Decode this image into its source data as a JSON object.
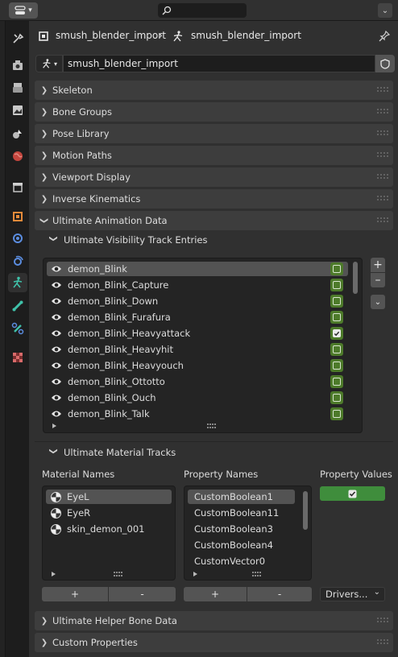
{
  "header": {
    "object_name": "smush_blender_import",
    "armature_name": "smush_blender_import"
  },
  "name_field": {
    "value": "smush_blender_import"
  },
  "sections": {
    "skeleton": "Skeleton",
    "bone_groups": "Bone Groups",
    "pose_library": "Pose Library",
    "motion_paths": "Motion Paths",
    "viewport_display": "Viewport Display",
    "inverse_kinematics": "Inverse Kinematics",
    "ultimate_animation_data": "Ultimate Animation Data",
    "ultimate_visibility_track_entries": "Ultimate Visibility Track Entries",
    "ultimate_material_tracks": "Ultimate Material Tracks",
    "ultimate_helper_bone_data": "Ultimate Helper Bone Data",
    "custom_properties": "Custom Properties"
  },
  "visibility_tracks": [
    {
      "name": "demon_Blink",
      "checked": false,
      "selected": true
    },
    {
      "name": "demon_Blink_Capture",
      "checked": false
    },
    {
      "name": "demon_Blink_Down",
      "checked": false
    },
    {
      "name": "demon_Blink_Furafura",
      "checked": false
    },
    {
      "name": "demon_Blink_Heavyattack",
      "checked": true
    },
    {
      "name": "demon_Blink_Heavyhit",
      "checked": false
    },
    {
      "name": "demon_Blink_Heavyouch",
      "checked": false
    },
    {
      "name": "demon_Blink_Ottotto",
      "checked": false
    },
    {
      "name": "demon_Blink_Ouch",
      "checked": false
    },
    {
      "name": "demon_Blink_Talk",
      "checked": false
    }
  ],
  "material_tracks": {
    "material_names_label": "Material Names",
    "property_names_label": "Property Names",
    "property_values_label": "Property Values",
    "materials": [
      "EyeL",
      "EyeR",
      "skin_demon_001"
    ],
    "properties": [
      "CustomBoolean1",
      "CustomBoolean11",
      "CustomBoolean3",
      "CustomBoolean4",
      "CustomVector0"
    ],
    "add_label": "+",
    "remove_label": "-",
    "drivers_label": "Drivers..."
  },
  "icons": {
    "side_tabs": [
      "tool-icon",
      "render-icon",
      "output-icon",
      "view-layer-icon",
      "scene-icon",
      "world-icon",
      "collection-icon",
      "object-icon",
      "modifiers-icon",
      "particles-icon",
      "physics-icon",
      "object-data-armature-icon",
      "bone-icon",
      "bone-constraint-icon",
      "texture-icon"
    ]
  },
  "colors": {
    "checkbox_green": "#4d7a2a",
    "property_value_green": "#3f8d3c",
    "selected_row": "#535353"
  }
}
